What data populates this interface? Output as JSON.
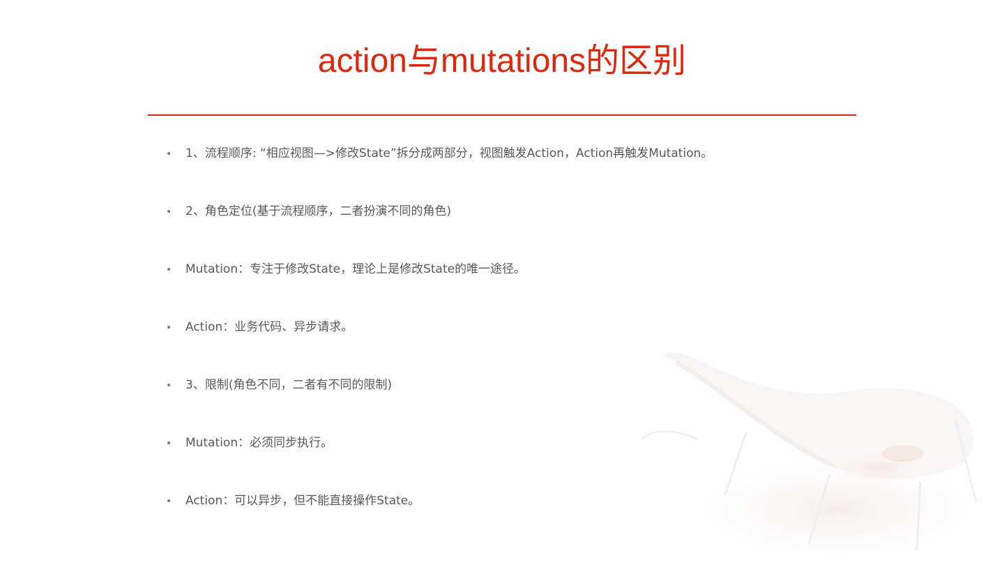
{
  "slide": {
    "title": "action与mutations的区别",
    "bullets": [
      "1、流程顺序: “相应视图—>修改State”拆分成两部分，视图触发Action，Action再触发Mutation。",
      "2、角色定位(基于流程顺序，二者扮演不同的角色)",
      "Mutation：专注于修改State，理论上是修改State的唯一途径。",
      "Action：业务代码、异步请求。",
      "3、限制(角色不同，二者有不同的限制)",
      "Mutation：必须同步执行。",
      "Action：可以异步，但不能直接操作State。"
    ]
  },
  "colors": {
    "accent": "#d9290f",
    "body_text": "#595959"
  },
  "decoration": {
    "icon": "faint-chair-watermark-graphic"
  }
}
